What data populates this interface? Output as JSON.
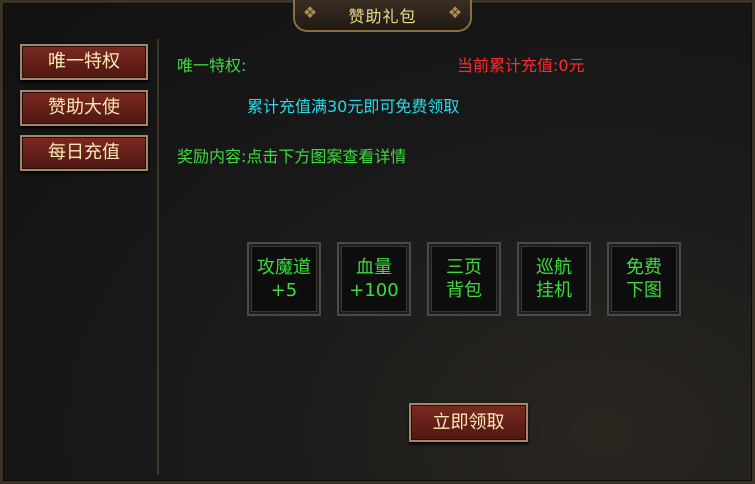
{
  "window": {
    "title": "赞助礼包"
  },
  "sidebar": {
    "items": [
      {
        "label": "唯一特权"
      },
      {
        "label": "赞助大使"
      },
      {
        "label": "每日充值"
      }
    ]
  },
  "content": {
    "section_label": "唯一特权:",
    "total_recharge": "当前累计充值:0元",
    "requirement": "累计充值满30元即可免费领取",
    "reward_hint": "奖励内容:点击下方图案查看详情",
    "rewards": [
      {
        "line1": "攻魔道",
        "line2": "+5"
      },
      {
        "line1": "血量",
        "line2": "+100"
      },
      {
        "line1": "三页",
        "line2": "背包"
      },
      {
        "line1": "巡航",
        "line2": "挂机"
      },
      {
        "line1": "免费",
        "line2": "下图"
      }
    ],
    "claim_label": "立即领取"
  },
  "colors": {
    "text_green": "#3edb3e",
    "text_red": "#ff2a2a",
    "text_cyan": "#2ad9e8",
    "button_red": "#7b2a22",
    "title_gold": "#f0d98c"
  }
}
